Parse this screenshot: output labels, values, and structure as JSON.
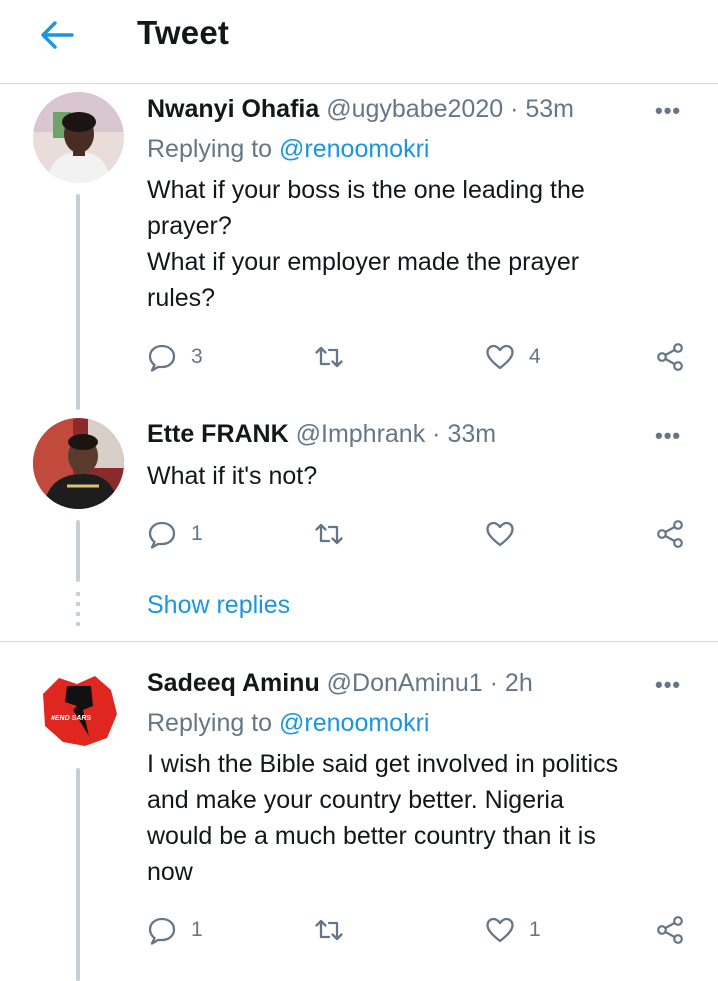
{
  "header": {
    "title": "Tweet",
    "back_icon": "arrow-left-icon"
  },
  "colors": {
    "accent": "#1b95e0",
    "muted": "#657786",
    "text": "#14171a",
    "thread_line": "#c4cfd6"
  },
  "tweets": [
    {
      "name": "Nwanyi Ohafia",
      "handle": "@ugybabe2020",
      "time": "53m",
      "replying_label": "Replying to",
      "replying_handle": "@renoomokri",
      "lines": [
        "What if your boss is the one leading the",
        "prayer?",
        "What if your employer made the prayer",
        "rules?"
      ],
      "reply_count": "3",
      "retweet_count": "",
      "like_count": "4"
    },
    {
      "name": "Ette FRANK",
      "handle": "@Imphrank",
      "time": "33m",
      "lines": [
        "What if it's  not?"
      ],
      "reply_count": "1",
      "retweet_count": "",
      "like_count": ""
    },
    {
      "name": "Sadeeq Aminu",
      "handle": "@DonAminu1",
      "time": "2h",
      "replying_label": "Replying to",
      "replying_handle": "@renoomokri",
      "lines": [
        "I wish the Bible said get involved in politics",
        "and make your country better. Nigeria",
        "would be a much better country than it is",
        "now"
      ],
      "reply_count": "1",
      "retweet_count": "",
      "like_count": "1",
      "avatar_text": "#END SARS"
    }
  ],
  "show_replies": "Show replies",
  "separator": "·",
  "more_label": "•••"
}
